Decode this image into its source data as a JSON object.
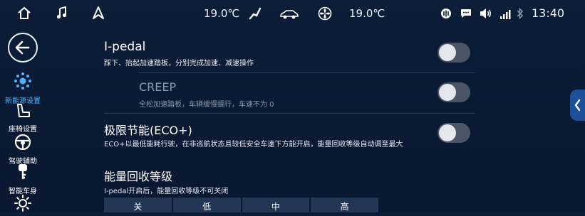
{
  "status_bar": {
    "left_temp": "19.0℃",
    "right_temp": "19.0℃",
    "time": "13:40",
    "icons": [
      "home-icon",
      "music-icon",
      "navigation-icon",
      "route-icon",
      "car-icon",
      "fan-icon",
      "voice-icon",
      "message-icon",
      "volume-icon",
      "signal-icon",
      "bluetooth-icon"
    ]
  },
  "nav": {
    "back": "back-icon",
    "items": [
      {
        "label": "新能源设置",
        "icon": "energy-settings-icon",
        "active": true
      },
      {
        "label": "座椅设置",
        "icon": "seat-icon",
        "active": false
      },
      {
        "label": "驾驶辅助",
        "icon": "steering-wheel-icon",
        "active": false
      },
      {
        "label": "智能车身",
        "icon": "car-key-icon",
        "active": false
      },
      {
        "label": "",
        "icon": "brightness-icon",
        "active": false
      }
    ]
  },
  "settings": {
    "ipedal": {
      "title": "I-pedal",
      "subtitle": "踩下、抬起加速踏板，分别完成加速、减速操作",
      "on": false
    },
    "creep": {
      "title": "CREEP",
      "subtitle": "全松加速踏板，车辆缓慢蠕行，车速不为 0",
      "on": false
    },
    "eco": {
      "title": "极限节能(ECO+)",
      "subtitle": "ECO+以最低能耗行驶，在非巡航状态且较低安全车速下方能开启，能量回收等级自动调至最大",
      "on": false
    },
    "regen": {
      "title": "能量回收等级",
      "subtitle": "I-pedal开启后，能量回收等级不可关闭",
      "options": [
        "关",
        "低",
        "中",
        "高"
      ]
    }
  },
  "colors": {
    "background": "#0c1d38",
    "accent": "#4fb2ff",
    "toggle_off": "#4b5566",
    "segment": "#233555"
  }
}
